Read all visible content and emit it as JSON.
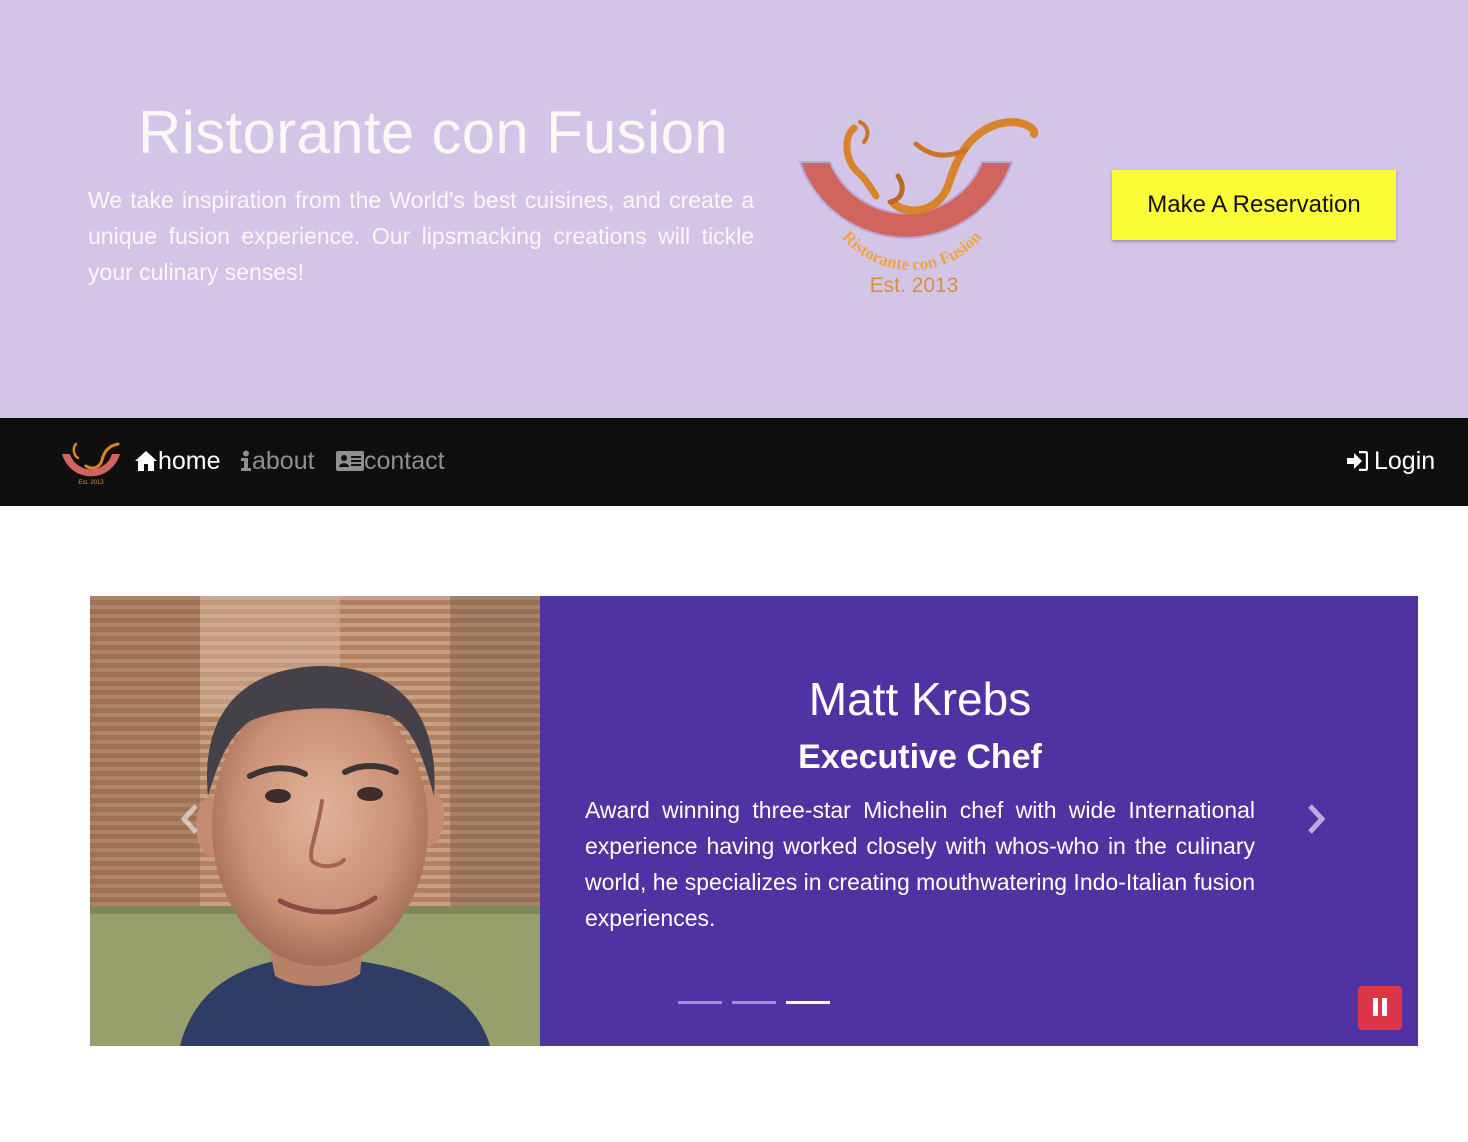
{
  "jumbotron": {
    "title": "Ristorante con Fusion",
    "description": "We take inspiration from the World's best cuisines, and create a unique fusion experience. Our lipsmacking creations will tickle your culinary senses!",
    "logo": {
      "arc_text": "Ristorante con Fusion",
      "established": "Est. 2013"
    },
    "reserve_button": "Make A Reservation"
  },
  "navbar": {
    "logo_icon": "restaurant-logo",
    "items": [
      {
        "label": "home",
        "icon": "home-icon",
        "active": true
      },
      {
        "label": "about",
        "icon": "info-icon",
        "active": false
      },
      {
        "label": "contact",
        "icon": "address-card-icon",
        "active": false
      }
    ],
    "login": {
      "label": "Login",
      "icon": "sign-in-icon"
    }
  },
  "carousel": {
    "slide": {
      "name": "Matt Krebs",
      "role": "Executive Chef",
      "description": "Award winning three-star Michelin chef with wide International experience having worked closely with whos-who in the culinary world, he specializes in creating mouthwatering Indo-Italian fusion experiences."
    },
    "indicators": [
      false,
      false,
      true
    ],
    "controls": {
      "prev": "chevron-left-icon",
      "next": "chevron-right-icon",
      "pause": "pause-icon"
    }
  },
  "colors": {
    "jumbotron_bg": "#d2c5e8",
    "navbar_bg": "#0f0f0f",
    "carousel_bg": "#5033a3",
    "reserve_button": "#fdfd38",
    "pause_button": "#dc3545"
  }
}
